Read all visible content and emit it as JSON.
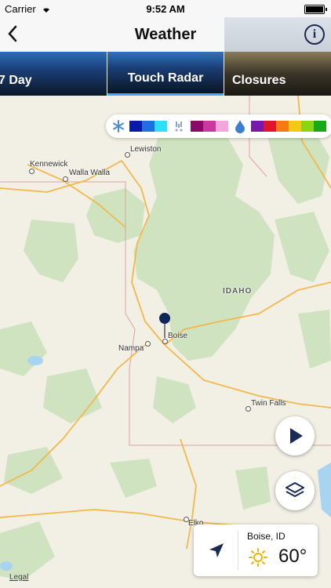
{
  "status_bar": {
    "carrier": "Carrier",
    "time": "9:52 AM"
  },
  "nav": {
    "title": "Weather",
    "back_icon": "chevron-left-icon",
    "info_icon": "info-icon"
  },
  "tabs": [
    {
      "label": "7 Day",
      "selected": false
    },
    {
      "label": "Touch Radar",
      "selected": true
    },
    {
      "label": "Closures",
      "selected": false
    }
  ],
  "legend": {
    "snow_icon": "snowflake-icon",
    "mix_icon": "mix-precip-icon",
    "rain_icon": "raindrop-icon",
    "snow_colors": [
      "#0a1aa8",
      "#1e6fe0",
      "#2ee0f5"
    ],
    "mix_colors": [
      "#8a0a6a",
      "#c8389f",
      "#f2a6dc"
    ],
    "rain_colors": [
      "#7a16a8",
      "#e0142a",
      "#f57a14",
      "#f5c814",
      "#8ad614",
      "#1aa81a"
    ]
  },
  "map": {
    "state_label": "IDAHO",
    "cities": [
      {
        "name": "Lewiston"
      },
      {
        "name": "Kennewick"
      },
      {
        "name": "Walla Walla"
      },
      {
        "name": "Boise"
      },
      {
        "name": "Nampa"
      },
      {
        "name": "Twin Falls"
      },
      {
        "name": "Elko"
      }
    ],
    "legal_link": "Legal"
  },
  "controls": {
    "play_icon": "play-icon",
    "layers_icon": "layers-icon"
  },
  "current": {
    "location_icon": "location-arrow-icon",
    "weather_icon": "sun-icon",
    "city": "Boise, ID",
    "temperature": "60°"
  }
}
